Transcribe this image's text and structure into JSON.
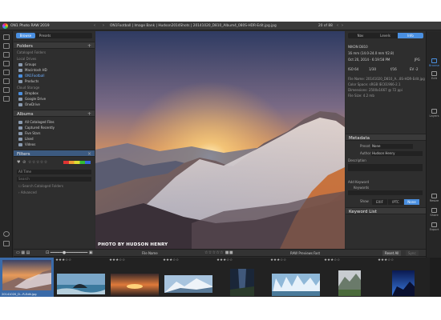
{
  "app": {
    "name": "ON1 Photo RAW 2019",
    "window_title": "ON1 Photo RAW 2019 - Browse",
    "path": "ON1Football | Image Bank | Hudson2014Shots | 20141020_D810_Album4_080S-HDR-Edit.jpg.jpg",
    "position": "20 of 88"
  },
  "left_panel": {
    "tabs": [
      "Browse",
      "Presets"
    ],
    "folders": {
      "title": "Folders",
      "catalog_label": "Cataloged Folders",
      "local_label": "Local Drives",
      "local_items": [
        "Groups",
        "Macintosh HD",
        "ON1Football",
        "Products"
      ],
      "cloud_label": "Cloud Storage",
      "cloud_items": [
        "Dropbox",
        "Google Drive",
        "OneDrive"
      ]
    },
    "albums": {
      "title": "Albums",
      "items": [
        "All Cataloged Files",
        "Captured Recently",
        "Five Stars",
        "Liked",
        "Videos"
      ]
    },
    "filters": {
      "title": "Filters",
      "time_label": "All Time",
      "search_placeholder": "Search",
      "search_catalog": "Search Cataloged Folders",
      "advanced": "Advanced"
    }
  },
  "viewer": {
    "credit": "PHOTO BY HUDSON HENRY"
  },
  "right_panel": {
    "tabs": [
      "Nav",
      "Levels",
      "Info"
    ],
    "camera": "NIKON D810",
    "lens_line": "16 mm (14.0-24.0 mm f/2.8)",
    "date": "Oct 20, 2014 · 6:19:58 PM",
    "format": "JPG",
    "exif": [
      "ISO 64",
      "1/30",
      "f/16",
      "EV -2"
    ],
    "file_name": "File Name: 20141020_D810_A...8S-HDR-Edit.jpg",
    "color_space": "Color Space: sRGB IEC61966-2.1",
    "dimensions": "Dimensions: 2500x1667 @ 72 ppi",
    "file_size": "File Size: 4.2 mb",
    "metadata": {
      "title": "Metadata",
      "preset_label": "Preset",
      "preset_value": "None",
      "author_label": "Author",
      "author_value": "Hudson Henry",
      "description_label": "Description",
      "add_keyword": "Add Keyword",
      "keywords_label": "Keywords",
      "show_label": "Show",
      "show_options": [
        "EXIF",
        "IPTC",
        "None"
      ]
    },
    "keyword_list": "Keyword List"
  },
  "right_strip": [
    "Browse",
    "Edit",
    "Layers",
    "Resize",
    "Share",
    "Export"
  ],
  "toolbar": {
    "sort_label": "File Name",
    "preview_label": "RAW Previews",
    "preview_value": "Fast",
    "reset_all": "Reset All",
    "sync": "Sync"
  },
  "filmstrip": {
    "selected_name": "20141020_D...R-Edit.jpg",
    "items": [
      {
        "stars": "★★★☆☆",
        "selected": true
      },
      {
        "stars": "★★★☆☆",
        "selected": false
      },
      {
        "stars": "★★★☆☆",
        "selected": false
      },
      {
        "stars": "★★★☆☆",
        "selected": false
      },
      {
        "stars": "★★★☆☆",
        "selected": false
      },
      {
        "stars": "★★★☆☆",
        "selected": false
      },
      {
        "stars": "★★★☆☆",
        "selected": false
      },
      {
        "stars": "★★★☆☆",
        "selected": false
      }
    ]
  },
  "colors": {
    "accent": "#4a8fe0",
    "panel": "#2e2e2e",
    "background": "#2b2b2b"
  }
}
